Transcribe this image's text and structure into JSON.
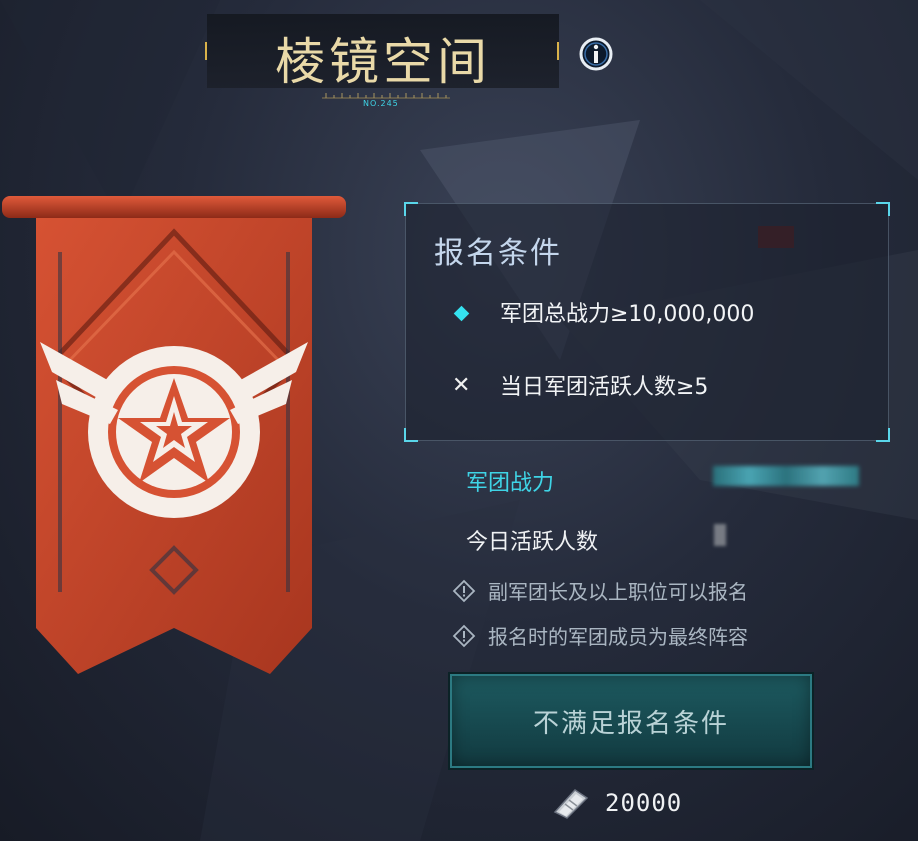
{
  "header": {
    "title": "棱镜空间",
    "ruler_code": "NO.245",
    "info_icon": "info-icon"
  },
  "banner": {
    "emblem_icon": "winged-star-emblem-icon",
    "color": "#d2492b"
  },
  "conditions": {
    "title": "报名条件",
    "items": [
      {
        "status_icon": "diamond-check-icon",
        "met": true,
        "text": "军团总战力≥10,000,000"
      },
      {
        "status_icon": "cross-icon",
        "met": false,
        "text": "当日军团活跃人数≥5"
      }
    ]
  },
  "stats": {
    "power_label": "军团战力",
    "active_label": "今日活跃人数"
  },
  "notes": [
    {
      "icon": "warning-icon",
      "text": "副军团长及以上职位可以报名"
    },
    {
      "icon": "warning-icon",
      "text": "报名时的军团成员为最终阵容"
    }
  ],
  "action_button": {
    "label": "不满足报名条件"
  },
  "cost": {
    "icon": "ticket-icon",
    "amount": "20000"
  },
  "colors": {
    "accent": "#3fd4e6",
    "title_gold": "#e9d9a8",
    "button": "#174a50"
  }
}
